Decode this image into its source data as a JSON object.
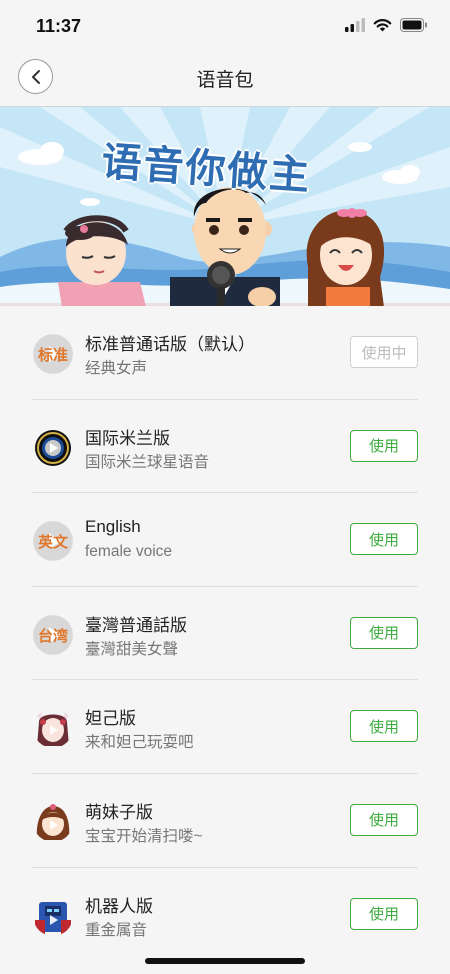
{
  "status": {
    "time": "11:37"
  },
  "nav": {
    "title": "语音包",
    "back_icon": "chevron-left-icon"
  },
  "banner": {
    "headline": "语音你做主"
  },
  "colors": {
    "accent": "#3eab3e",
    "banner_sky": "#bfe3f6",
    "banner_text": "#2f6db3"
  },
  "items": [
    {
      "title": "标准普通话版（默认）",
      "subtitle": "经典女声",
      "button": "使用中",
      "active": true,
      "icon": "standard-mandarin-icon",
      "icon_text": "标准"
    },
    {
      "title": "国际米兰版",
      "subtitle": "国际米兰球星语音",
      "button": "使用",
      "active": false,
      "icon": "inter-milan-icon"
    },
    {
      "title": "English",
      "subtitle": "female voice",
      "button": "使用",
      "active": false,
      "icon": "english-icon",
      "icon_text": "英文"
    },
    {
      "title": "臺灣普通話版",
      "subtitle": "臺灣甜美女聲",
      "button": "使用",
      "active": false,
      "icon": "taiwan-icon",
      "icon_text": "台湾"
    },
    {
      "title": "妲己版",
      "subtitle": "来和妲己玩耍吧",
      "button": "使用",
      "active": false,
      "icon": "daji-avatar-icon"
    },
    {
      "title": "萌妹子版",
      "subtitle": "宝宝开始清扫喽~",
      "button": "使用",
      "active": false,
      "icon": "cute-girl-avatar-icon"
    },
    {
      "title": "机器人版",
      "subtitle": "重金属音",
      "button": "使用",
      "active": false,
      "icon": "robot-avatar-icon"
    }
  ]
}
